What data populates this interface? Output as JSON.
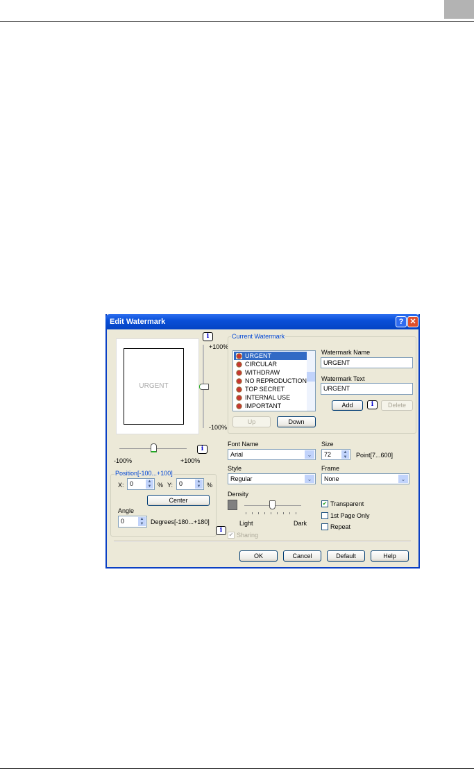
{
  "dialog": {
    "title": "Edit Watermark",
    "help_btn": "?",
    "close_btn": "✕"
  },
  "preview": {
    "text": "URGENT",
    "v_top": "+100%",
    "v_bottom": "-100%",
    "h_left": "-100%",
    "h_right": "+100%"
  },
  "current": {
    "label": "Current Watermark",
    "items": [
      "URGENT",
      "CIRCULAR",
      "WITHDRAW",
      "NO REPRODUCTION",
      "TOP SECRET",
      "INTERNAL USE",
      "IMPORTANT"
    ],
    "selected": 0,
    "name_label": "Watermark Name",
    "name_value": "URGENT",
    "text_label": "Watermark Text",
    "text_value": "URGENT",
    "add": "Add",
    "delete": "Delete",
    "up": "Up",
    "down": "Down"
  },
  "position": {
    "label": "Position[-100...+100]",
    "x_label": "X:",
    "x_value": "0",
    "y_label": "Y:",
    "y_value": "0",
    "pct": "%",
    "center": "Center",
    "angle_label": "Angle",
    "angle_value": "0",
    "angle_range": "Degrees[-180...+180]"
  },
  "font": {
    "font_label": "Font Name",
    "font_value": "Arial",
    "size_label": "Size",
    "size_value": "72",
    "size_range": "Point[7...600]",
    "style_label": "Style",
    "style_value": "Regular",
    "frame_label": "Frame",
    "frame_value": "None"
  },
  "density": {
    "label": "Density",
    "light": "Light",
    "dark": "Dark",
    "value_fraction": 0.5
  },
  "options": {
    "transparent": "Transparent",
    "transparent_checked": true,
    "first_page": "1st Page Only",
    "first_checked": false,
    "repeat": "Repeat",
    "repeat_checked": false,
    "sharing": "Sharing",
    "sharing_checked": true
  },
  "buttons": {
    "ok": "OK",
    "cancel": "Cancel",
    "default": "Default",
    "help": "Help"
  },
  "info_icon": "i",
  "colors": {
    "title": "#0a4fd8",
    "group_label": "#0046d5",
    "selection": "#316ac5"
  }
}
